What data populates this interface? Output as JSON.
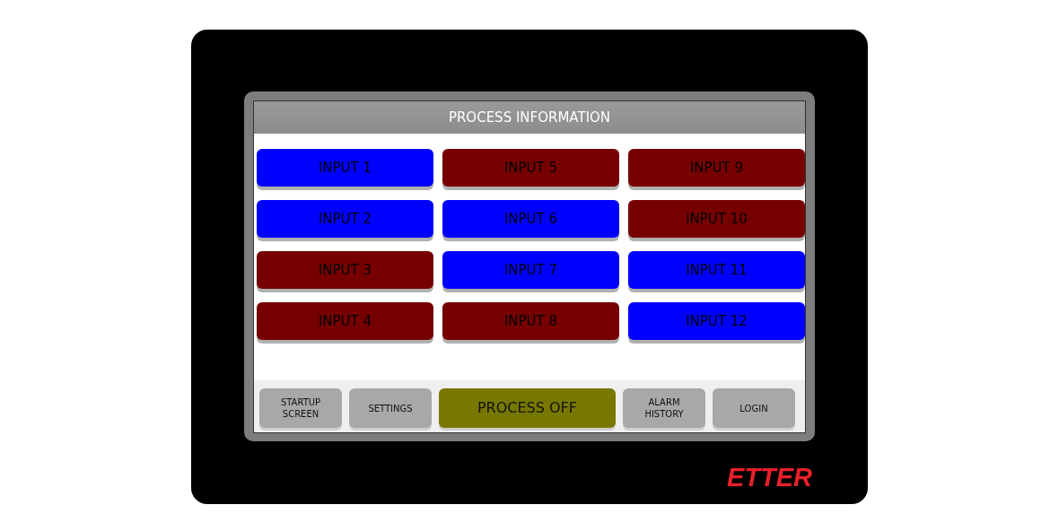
{
  "screen": {
    "title": "PROCESS INFORMATION"
  },
  "inputs": [
    {
      "label": "INPUT 1",
      "on": true
    },
    {
      "label": "INPUT 2",
      "on": true
    },
    {
      "label": "INPUT 3",
      "on": false
    },
    {
      "label": "INPUT 4",
      "on": false
    },
    {
      "label": "INPUT 5",
      "on": false
    },
    {
      "label": "INPUT 6",
      "on": true
    },
    {
      "label": "INPUT 7",
      "on": true
    },
    {
      "label": "INPUT 8",
      "on": false
    },
    {
      "label": "INPUT 9",
      "on": false
    },
    {
      "label": "INPUT 10",
      "on": false
    },
    {
      "label": "INPUT 11",
      "on": true
    },
    {
      "label": "INPUT 12",
      "on": true
    }
  ],
  "buttons": [
    {
      "label": "STARTUP SCREEN",
      "kind": "nav"
    },
    {
      "label": "SETTINGS",
      "kind": "nav"
    },
    {
      "label": "PROCESS OFF",
      "kind": "status"
    },
    {
      "label": "ALARM HISTORY",
      "kind": "nav"
    },
    {
      "label": "LOGIN",
      "kind": "nav"
    }
  ],
  "brand": "ETTER"
}
